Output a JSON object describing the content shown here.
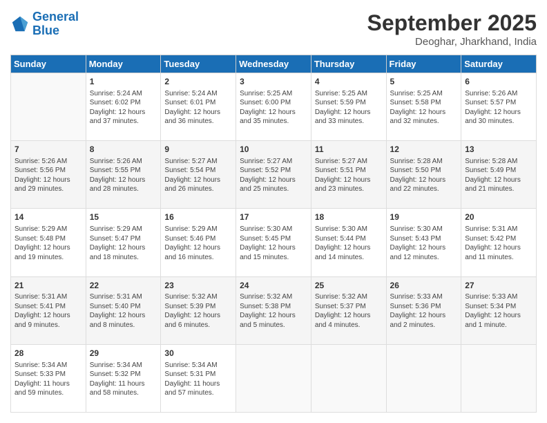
{
  "header": {
    "logo_line1": "General",
    "logo_line2": "Blue",
    "month": "September 2025",
    "location": "Deoghar, Jharkhand, India"
  },
  "weekdays": [
    "Sunday",
    "Monday",
    "Tuesday",
    "Wednesday",
    "Thursday",
    "Friday",
    "Saturday"
  ],
  "weeks": [
    [
      {
        "day": "",
        "content": ""
      },
      {
        "day": "1",
        "content": "Sunrise: 5:24 AM\nSunset: 6:02 PM\nDaylight: 12 hours\nand 37 minutes."
      },
      {
        "day": "2",
        "content": "Sunrise: 5:24 AM\nSunset: 6:01 PM\nDaylight: 12 hours\nand 36 minutes."
      },
      {
        "day": "3",
        "content": "Sunrise: 5:25 AM\nSunset: 6:00 PM\nDaylight: 12 hours\nand 35 minutes."
      },
      {
        "day": "4",
        "content": "Sunrise: 5:25 AM\nSunset: 5:59 PM\nDaylight: 12 hours\nand 33 minutes."
      },
      {
        "day": "5",
        "content": "Sunrise: 5:25 AM\nSunset: 5:58 PM\nDaylight: 12 hours\nand 32 minutes."
      },
      {
        "day": "6",
        "content": "Sunrise: 5:26 AM\nSunset: 5:57 PM\nDaylight: 12 hours\nand 30 minutes."
      }
    ],
    [
      {
        "day": "7",
        "content": "Sunrise: 5:26 AM\nSunset: 5:56 PM\nDaylight: 12 hours\nand 29 minutes."
      },
      {
        "day": "8",
        "content": "Sunrise: 5:26 AM\nSunset: 5:55 PM\nDaylight: 12 hours\nand 28 minutes."
      },
      {
        "day": "9",
        "content": "Sunrise: 5:27 AM\nSunset: 5:54 PM\nDaylight: 12 hours\nand 26 minutes."
      },
      {
        "day": "10",
        "content": "Sunrise: 5:27 AM\nSunset: 5:52 PM\nDaylight: 12 hours\nand 25 minutes."
      },
      {
        "day": "11",
        "content": "Sunrise: 5:27 AM\nSunset: 5:51 PM\nDaylight: 12 hours\nand 23 minutes."
      },
      {
        "day": "12",
        "content": "Sunrise: 5:28 AM\nSunset: 5:50 PM\nDaylight: 12 hours\nand 22 minutes."
      },
      {
        "day": "13",
        "content": "Sunrise: 5:28 AM\nSunset: 5:49 PM\nDaylight: 12 hours\nand 21 minutes."
      }
    ],
    [
      {
        "day": "14",
        "content": "Sunrise: 5:29 AM\nSunset: 5:48 PM\nDaylight: 12 hours\nand 19 minutes."
      },
      {
        "day": "15",
        "content": "Sunrise: 5:29 AM\nSunset: 5:47 PM\nDaylight: 12 hours\nand 18 minutes."
      },
      {
        "day": "16",
        "content": "Sunrise: 5:29 AM\nSunset: 5:46 PM\nDaylight: 12 hours\nand 16 minutes."
      },
      {
        "day": "17",
        "content": "Sunrise: 5:30 AM\nSunset: 5:45 PM\nDaylight: 12 hours\nand 15 minutes."
      },
      {
        "day": "18",
        "content": "Sunrise: 5:30 AM\nSunset: 5:44 PM\nDaylight: 12 hours\nand 14 minutes."
      },
      {
        "day": "19",
        "content": "Sunrise: 5:30 AM\nSunset: 5:43 PM\nDaylight: 12 hours\nand 12 minutes."
      },
      {
        "day": "20",
        "content": "Sunrise: 5:31 AM\nSunset: 5:42 PM\nDaylight: 12 hours\nand 11 minutes."
      }
    ],
    [
      {
        "day": "21",
        "content": "Sunrise: 5:31 AM\nSunset: 5:41 PM\nDaylight: 12 hours\nand 9 minutes."
      },
      {
        "day": "22",
        "content": "Sunrise: 5:31 AM\nSunset: 5:40 PM\nDaylight: 12 hours\nand 8 minutes."
      },
      {
        "day": "23",
        "content": "Sunrise: 5:32 AM\nSunset: 5:39 PM\nDaylight: 12 hours\nand 6 minutes."
      },
      {
        "day": "24",
        "content": "Sunrise: 5:32 AM\nSunset: 5:38 PM\nDaylight: 12 hours\nand 5 minutes."
      },
      {
        "day": "25",
        "content": "Sunrise: 5:32 AM\nSunset: 5:37 PM\nDaylight: 12 hours\nand 4 minutes."
      },
      {
        "day": "26",
        "content": "Sunrise: 5:33 AM\nSunset: 5:36 PM\nDaylight: 12 hours\nand 2 minutes."
      },
      {
        "day": "27",
        "content": "Sunrise: 5:33 AM\nSunset: 5:34 PM\nDaylight: 12 hours\nand 1 minute."
      }
    ],
    [
      {
        "day": "28",
        "content": "Sunrise: 5:34 AM\nSunset: 5:33 PM\nDaylight: 11 hours\nand 59 minutes."
      },
      {
        "day": "29",
        "content": "Sunrise: 5:34 AM\nSunset: 5:32 PM\nDaylight: 11 hours\nand 58 minutes."
      },
      {
        "day": "30",
        "content": "Sunrise: 5:34 AM\nSunset: 5:31 PM\nDaylight: 11 hours\nand 57 minutes."
      },
      {
        "day": "",
        "content": ""
      },
      {
        "day": "",
        "content": ""
      },
      {
        "day": "",
        "content": ""
      },
      {
        "day": "",
        "content": ""
      }
    ]
  ]
}
